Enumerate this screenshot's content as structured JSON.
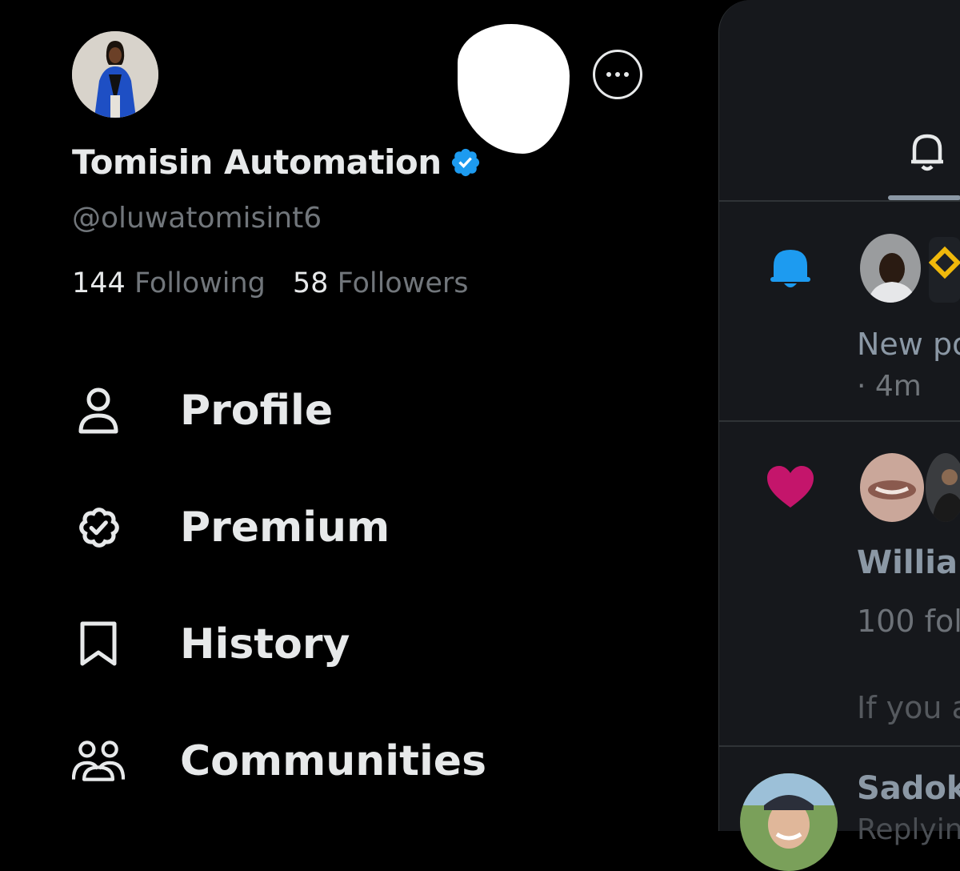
{
  "profile": {
    "display_name": "Tomisin Automation",
    "handle": "@oluwatomisint6",
    "following_count": "144",
    "following_label": "Following",
    "followers_count": "58",
    "followers_label": "Followers"
  },
  "menu": {
    "items": [
      {
        "label": "Profile",
        "icon": "person-icon"
      },
      {
        "label": "Premium",
        "icon": "verified-badge-icon"
      },
      {
        "label": "History",
        "icon": "bookmark-icon"
      },
      {
        "label": "Communities",
        "icon": "people-icon"
      }
    ]
  },
  "notifications": {
    "items": [
      {
        "icon": "bell-icon",
        "text": "New po",
        "time": "· 4m"
      },
      {
        "icon": "heart-icon",
        "name": "William",
        "text": "100 fol",
        "extra": "If you a"
      },
      {
        "name": "Sadok",
        "text": "Replyin"
      }
    ]
  },
  "colors": {
    "background": "#000000",
    "panel": "#16181c",
    "text_primary": "#e7e9ea",
    "text_secondary": "#71767b",
    "verified": "#1d9bf0",
    "bell_accent": "#1d9bf0",
    "heart": "#f91880"
  }
}
